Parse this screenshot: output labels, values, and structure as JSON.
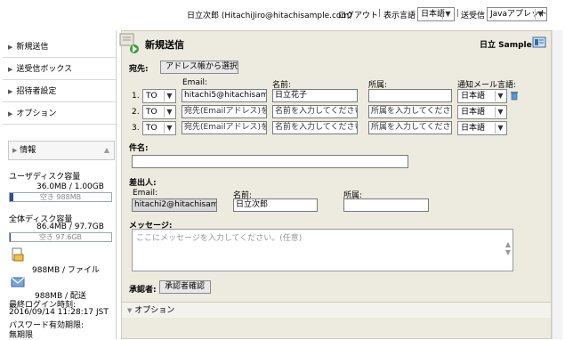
{
  "topbar": {
    "user": "日立次郎 (HitachiJiro@hitachisample.com)",
    "logout": "ログアウト",
    "language_label": "表示言語",
    "language_value": "日本語",
    "receive_label": "送受信",
    "receive_value": "Javaアプレット"
  },
  "sidebar": {
    "items": [
      "新規送信",
      "送受信ボックス",
      "招待者設定",
      "オプション"
    ],
    "info_label": "情報",
    "user_disk_label": "ユーザディスク容量",
    "user_disk_value": "36.0MB / 1.00GB",
    "user_disk_free": "空き 988MB",
    "user_disk_fraction": 0.035,
    "total_disk_label": "全体ディスク容量",
    "total_disk_value": "86.4MB / 97.7GB",
    "total_disk_free": "空き 97.6GB",
    "total_disk_fraction": 0.001,
    "per_file_value": "988MB / ファイル",
    "per_delivery_value": "988MB / 配送",
    "last_login_label": "最終ログイン時刻:",
    "last_login_value": "2016/09/14 11:28:17 JST",
    "password_label": "パスワード有効期限:",
    "password_value": "無期限"
  },
  "main": {
    "title": "新規送信",
    "brand": "日立 Sample",
    "to_label": "宛先:",
    "address_book_button": "アドレス帳から選択",
    "col_email": "Email:",
    "col_name": "名前:",
    "col_org": "所属:",
    "col_lang": "通知メール言語:",
    "recipients": [
      {
        "index": "1.",
        "type": "TO",
        "email": "hitachi5@hitachisamp",
        "name": "日立花子",
        "org": "",
        "lang": "日本語"
      },
      {
        "index": "2.",
        "type": "TO",
        "email": "宛先(Emailアドレス)を",
        "name": "名前を入力してください。",
        "org": "所属を入力してください。",
        "lang": "日本語"
      },
      {
        "index": "3.",
        "type": "TO",
        "email": "宛先(Emailアドレス)を",
        "name": "名前を入力してください。",
        "org": "所属を入力してください。",
        "lang": "日本語"
      }
    ],
    "subject_label": "件名:",
    "subject_value": "",
    "sender_label": "差出人:",
    "sender_email_label": "Email:",
    "sender_name_label": "名前:",
    "sender_org_label": "所属:",
    "sender_email": "hitachi2@hitachisamp",
    "sender_name": "日立次郎",
    "sender_org": "",
    "message_label": "メッセージ:",
    "message_placeholder": "ここにメッセージを入力してください。(任意)",
    "approver_label": "承認者:",
    "approver_button": "承認者確認",
    "options_label": "オプション"
  }
}
